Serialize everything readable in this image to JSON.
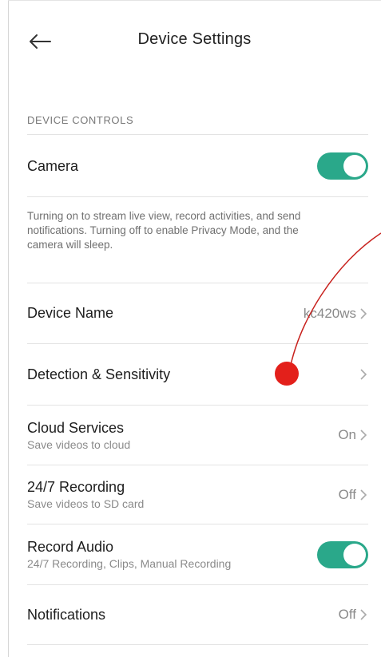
{
  "header": {
    "title": "Device Settings",
    "back_icon": "arrow-left-icon"
  },
  "section": {
    "label": "DEVICE CONTROLS"
  },
  "camera": {
    "label": "Camera",
    "toggle_on": true,
    "description": "Turning on to stream live view, record activities, and send notifications. Turning off to enable Privacy Mode, and the camera will sleep."
  },
  "rows": {
    "device_name": {
      "label": "Device Name",
      "value": "kc420ws"
    },
    "detection": {
      "label": "Detection & Sensitivity",
      "value": ""
    },
    "cloud": {
      "label": "Cloud Services",
      "sub": "Save videos to cloud",
      "value": "On"
    },
    "recording": {
      "label": "24/7 Recording",
      "sub": "Save videos to SD card",
      "value": "Off"
    },
    "record_audio": {
      "label": "Record Audio",
      "sub": "24/7 Recording, Clips, Manual Recording",
      "toggle_on": true
    },
    "notifications": {
      "label": "Notifications",
      "value": "Off"
    }
  },
  "colors": {
    "accent": "#2aa88a",
    "annotation": "#e3201b"
  }
}
